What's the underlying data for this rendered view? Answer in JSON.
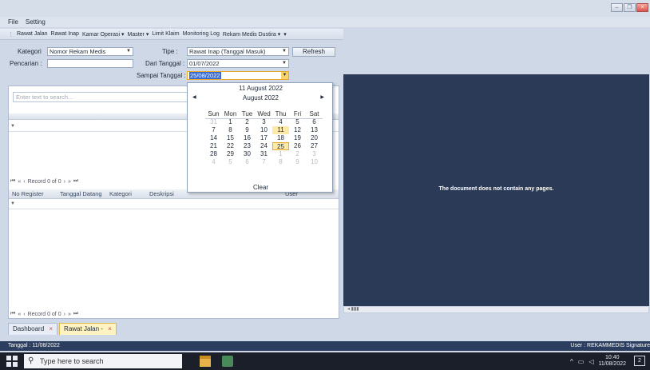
{
  "menu": {
    "file": "File",
    "setting": "Setting"
  },
  "toolbar": {
    "items": [
      "Rawat Jalan",
      "Rawat Inap",
      "Kamar Operasi ▾",
      "Master ▾",
      "Limit Klaim",
      "Monitoring Log",
      "Rekam Medis Dustira ▾"
    ],
    "overflow": "▾"
  },
  "filters": {
    "kategori_label": "Kategori",
    "kategori_value": "Nomor Rekam Medis",
    "pencarian_label": "Pencarian :",
    "pencarian_value": "",
    "tipe_label": "Tipe :",
    "tipe_value": "Rawat Inap (Tanggal Masuk)",
    "dari_label": "Dari Tanggal :",
    "dari_value": "01/07/2022",
    "sampai_label": "Sampai Tanggal :",
    "sampai_value": "25/08/2022",
    "refresh_label": "Refresh"
  },
  "search": {
    "placeholder": "Enter text to search..."
  },
  "grid_top": {
    "nav": "Record 0 of 0"
  },
  "grid_bottom": {
    "columns": [
      "No Register",
      "Tanggal Datang",
      "Kategori",
      "Deskripsi",
      "User"
    ],
    "nav": "Record 0 of 0"
  },
  "calendar": {
    "today": "11 August 2022",
    "month": "August 2022",
    "weekdays": [
      "Sun",
      "Mon",
      "Tue",
      "Wed",
      "Thu",
      "Fri",
      "Sat"
    ],
    "weeks": [
      [
        "31",
        "1",
        "2",
        "3",
        "4",
        "5",
        "6"
      ],
      [
        "7",
        "8",
        "9",
        "10",
        "11",
        "12",
        "13"
      ],
      [
        "14",
        "15",
        "16",
        "17",
        "18",
        "19",
        "20"
      ],
      [
        "21",
        "22",
        "23",
        "24",
        "25",
        "26",
        "27"
      ],
      [
        "28",
        "29",
        "30",
        "31",
        "1",
        "2",
        "3"
      ],
      [
        "4",
        "5",
        "6",
        "7",
        "8",
        "9",
        "10"
      ]
    ],
    "today_day": "11",
    "selected_day": "25",
    "clear": "Clear"
  },
  "document": {
    "message": "The document does not contain any pages."
  },
  "tabs": [
    {
      "label": "Dashboard",
      "close": "×"
    },
    {
      "label": "Rawat Jalan -",
      "close": "×"
    }
  ],
  "status": {
    "left": "Tanggal : 11/08/2022",
    "right": "User : REKAMMEDIS Signature"
  },
  "taskbar": {
    "search": "Type here to search",
    "time": "10:40",
    "date": "11/08/2022"
  },
  "colors": {
    "doc_bg": "#2b3a56",
    "status_bg": "#2c3e60",
    "highlight": "#fde9a8",
    "selection": "#3a6bd0"
  }
}
